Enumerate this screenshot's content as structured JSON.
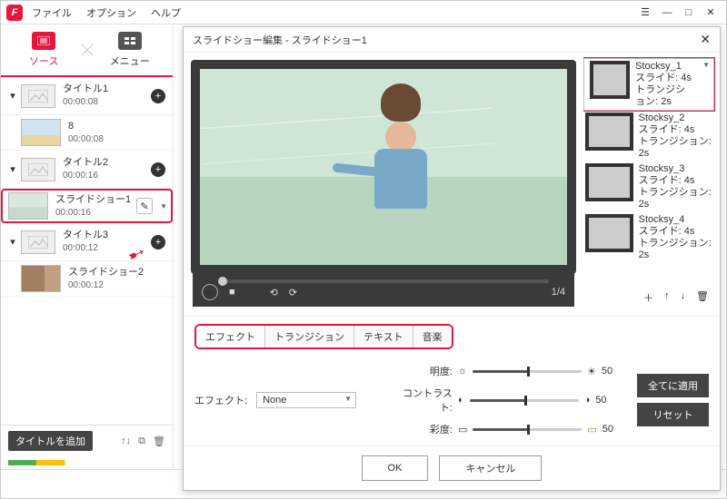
{
  "menus": {
    "file": "ファイル",
    "option": "オプション",
    "help": "ヘルプ"
  },
  "source_tabs": {
    "source": "ソース",
    "menu": "メニュー"
  },
  "titles": [
    {
      "name": "タイトル1",
      "time": "00:00:08",
      "children": [
        {
          "name": "8",
          "time": "00:00:08",
          "thumb": "thumb-beach"
        }
      ]
    },
    {
      "name": "タイトル2",
      "time": "00:00:16",
      "children": [
        {
          "name": "スライドショー1",
          "time": "00:00:16",
          "thumb": "thumb-img1",
          "selected": true
        }
      ]
    },
    {
      "name": "タイトル3",
      "time": "00:00:12",
      "children": [
        {
          "name": "スライドショー2",
          "time": "00:00:12",
          "thumb": "thumb-door"
        }
      ]
    }
  ],
  "side_foot": {
    "add_title": "タイトルを追加"
  },
  "dialog": {
    "title": "スライドショー編集  -  スライドショー1",
    "counter": "1/4",
    "slides": [
      {
        "name": "Stocksy_1",
        "slide": "スライド: 4s",
        "trans": "トランジション: 2s",
        "thumb": "thumb-img1",
        "selected": true
      },
      {
        "name": "Stocksy_2",
        "slide": "スライド: 4s",
        "trans": "トランジション: 2s",
        "thumb": "thumb-img2"
      },
      {
        "name": "Stocksy_3",
        "slide": "スライド: 4s",
        "trans": "トランジション: 2s",
        "thumb": "thumb-img3"
      },
      {
        "name": "Stocksy_4",
        "slide": "スライド: 4s",
        "trans": "トランジション: 2s",
        "thumb": "thumb-img4"
      }
    ],
    "tabs": {
      "effect": "エフェクト",
      "transition": "トランジション",
      "text": "テキスト",
      "music": "音楽"
    },
    "effect_label": "エフェクト:",
    "effect_value": "None",
    "sliders": {
      "brightness": {
        "label": "明度:",
        "value": "50"
      },
      "contrast": {
        "label": "コントラスト:",
        "value": "50"
      },
      "saturation": {
        "label": "彩度:",
        "value": "50"
      }
    },
    "apply_all": "全てに適用",
    "reset": "リセット",
    "ok": "OK",
    "cancel": "キャンセル"
  }
}
